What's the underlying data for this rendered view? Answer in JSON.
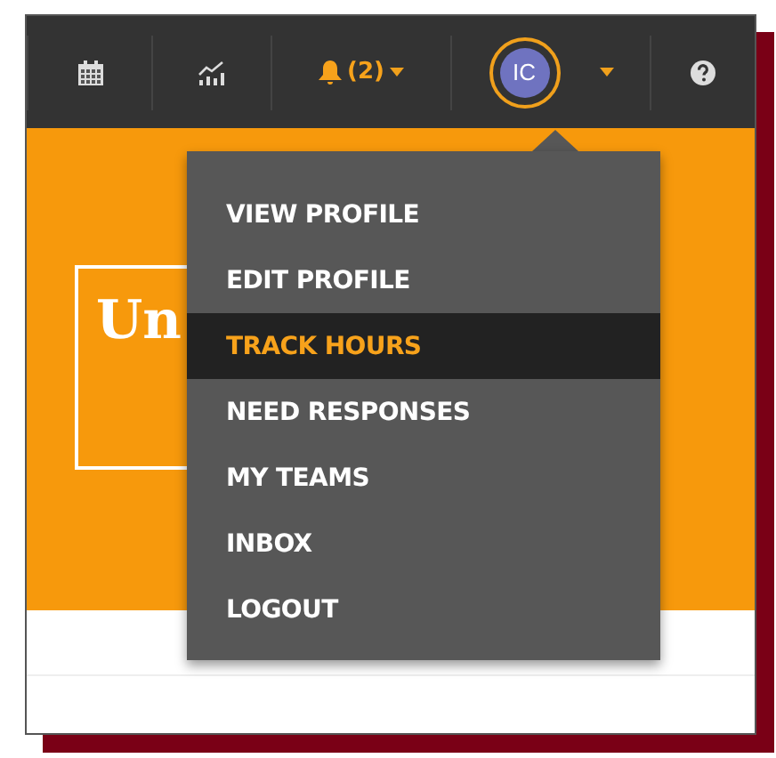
{
  "navbar": {
    "notifications": {
      "count": "(2)"
    },
    "avatar": {
      "initials": "IC"
    }
  },
  "banner": {
    "logo_text": "Un"
  },
  "user_menu": {
    "items": [
      {
        "label": "VIEW PROFILE",
        "selected": false
      },
      {
        "label": "EDIT PROFILE",
        "selected": false
      },
      {
        "label": "TRACK HOURS",
        "selected": true
      },
      {
        "label": "NEED RESPONSES",
        "selected": false
      },
      {
        "label": "MY TEAMS",
        "selected": false
      },
      {
        "label": "INBOX",
        "selected": false
      },
      {
        "label": "LOGOUT",
        "selected": false
      }
    ]
  }
}
